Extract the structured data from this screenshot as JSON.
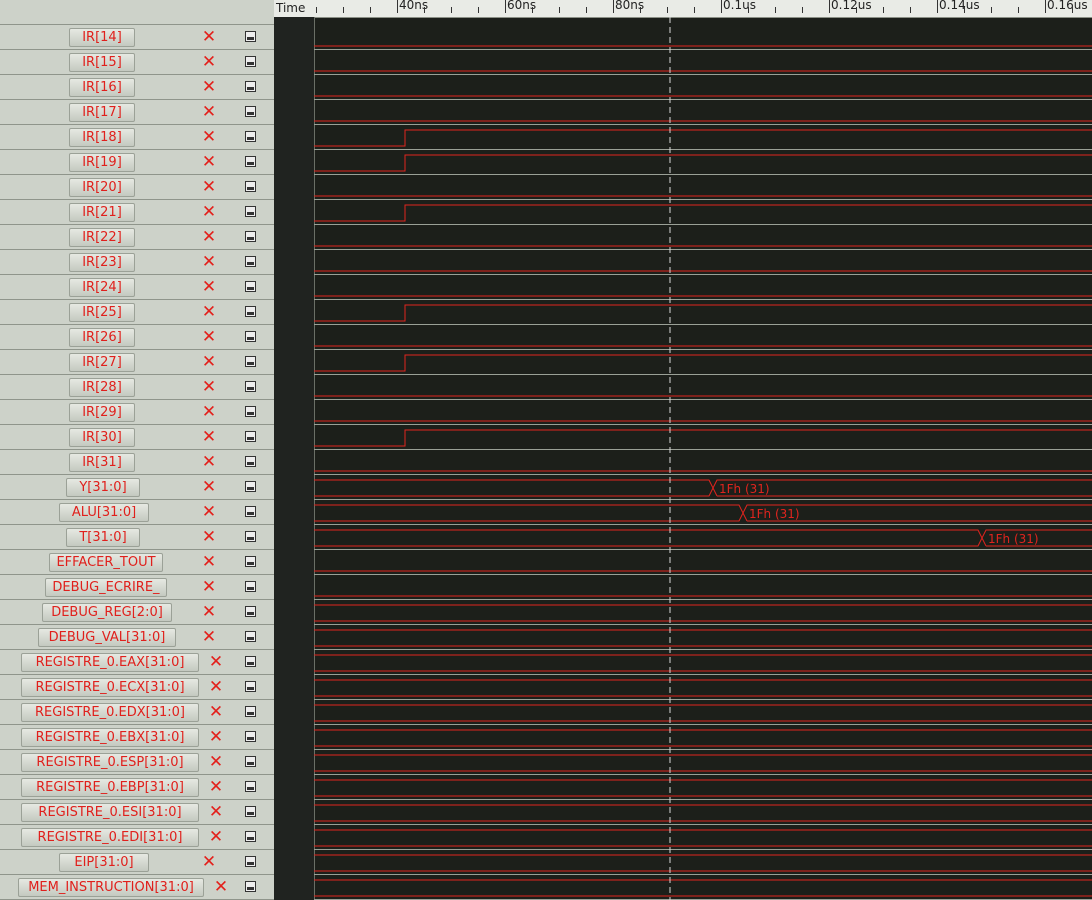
{
  "toolbar": {
    "icons": [
      "refresh-icon",
      "first-icon",
      "prev-icon",
      "stop-icon",
      "next-icon",
      "last-icon",
      "collapse-up-icon",
      "collapse-down-icon"
    ]
  },
  "header": {
    "time_label": "Time",
    "ticks": [
      {
        "label": "40ns"
      },
      {
        "label": "60ns"
      },
      {
        "label": "80ns"
      },
      {
        "label": "0.1us"
      },
      {
        "label": "0.12us"
      },
      {
        "label": "0.14us"
      },
      {
        "label": "0.16us"
      }
    ]
  },
  "signals": [
    {
      "name": "IR[14]",
      "wave": "low"
    },
    {
      "name": "IR[15]",
      "wave": "low"
    },
    {
      "name": "IR[16]",
      "wave": "low"
    },
    {
      "name": "IR[17]",
      "wave": "low"
    },
    {
      "name": "IR[18]",
      "wave": "rise"
    },
    {
      "name": "IR[19]",
      "wave": "rise"
    },
    {
      "name": "IR[20]",
      "wave": "low"
    },
    {
      "name": "IR[21]",
      "wave": "rise"
    },
    {
      "name": "IR[22]",
      "wave": "low"
    },
    {
      "name": "IR[23]",
      "wave": "low"
    },
    {
      "name": "IR[24]",
      "wave": "low"
    },
    {
      "name": "IR[25]",
      "wave": "rise"
    },
    {
      "name": "IR[26]",
      "wave": "low"
    },
    {
      "name": "IR[27]",
      "wave": "rise"
    },
    {
      "name": "IR[28]",
      "wave": "low"
    },
    {
      "name": "IR[29]",
      "wave": "low"
    },
    {
      "name": "IR[30]",
      "wave": "rise"
    },
    {
      "name": "IR[31]",
      "wave": "low"
    },
    {
      "name": "Y[31:0]",
      "wave": "bus",
      "value": "1Fh (31)"
    },
    {
      "name": "ALU[31:0]",
      "wave": "bus",
      "value": "1Fh (31)"
    },
    {
      "name": "T[31:0]",
      "wave": "bus",
      "value": "1Fh (31)"
    },
    {
      "name": "EFFACER_TOUT",
      "wave": "low"
    },
    {
      "name": "DEBUG_ECRIRE_",
      "wave": "low"
    },
    {
      "name": "DEBUG_REG[2:0]",
      "wave": "bus"
    },
    {
      "name": "DEBUG_VAL[31:0]",
      "wave": "bus"
    },
    {
      "name": "REGISTRE_0.EAX[31:0]",
      "wave": "bus"
    },
    {
      "name": "REGISTRE_0.ECX[31:0]",
      "wave": "bus"
    },
    {
      "name": "REGISTRE_0.EDX[31:0]",
      "wave": "bus"
    },
    {
      "name": "REGISTRE_0.EBX[31:0]",
      "wave": "bus"
    },
    {
      "name": "REGISTRE_0.ESP[31:0]",
      "wave": "bus"
    },
    {
      "name": "REGISTRE_0.EBP[31:0]",
      "wave": "bus"
    },
    {
      "name": "REGISTRE_0.ESI[31:0]",
      "wave": "bus"
    },
    {
      "name": "REGISTRE_0.EDI[31:0]",
      "wave": "bus"
    },
    {
      "name": "EIP[31:0]",
      "wave": "bus"
    },
    {
      "name": "MEM_INSTRUCTION[31:0]",
      "wave": "bus"
    }
  ],
  "colors": {
    "wave": "#e0241e",
    "grid": "#9aa096",
    "cursor": "#d8d8d8"
  }
}
